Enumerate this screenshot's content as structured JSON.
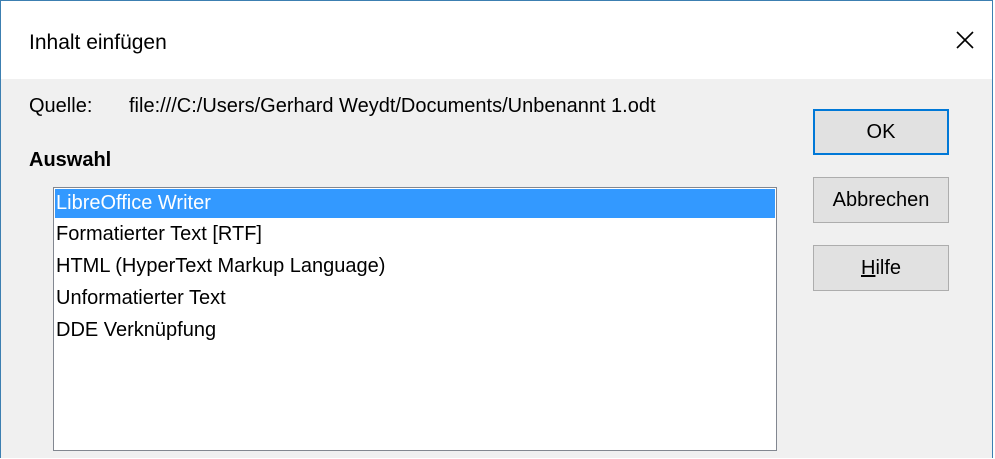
{
  "dialog": {
    "title": "Inhalt einfügen"
  },
  "source": {
    "label": "Quelle:",
    "value": "file:///C:/Users/Gerhard Weydt/Documents/Unbenannt 1.odt"
  },
  "selection": {
    "heading": "Auswahl",
    "items": [
      {
        "label": "LibreOffice Writer",
        "selected": true
      },
      {
        "label": "Formatierter Text [RTF]",
        "selected": false
      },
      {
        "label": "HTML (HyperText Markup Language)",
        "selected": false
      },
      {
        "label": "Unformatierter Text",
        "selected": false
      },
      {
        "label": "DDE Verknüpfung",
        "selected": false
      }
    ]
  },
  "buttons": {
    "ok": "OK",
    "cancel": "Abbrechen",
    "help_mnemonic": "H",
    "help_rest": "ilfe"
  },
  "colors": {
    "selection": "#3399ff",
    "default_button_border": "#0078d7",
    "window_border": "#3c7fb1"
  }
}
